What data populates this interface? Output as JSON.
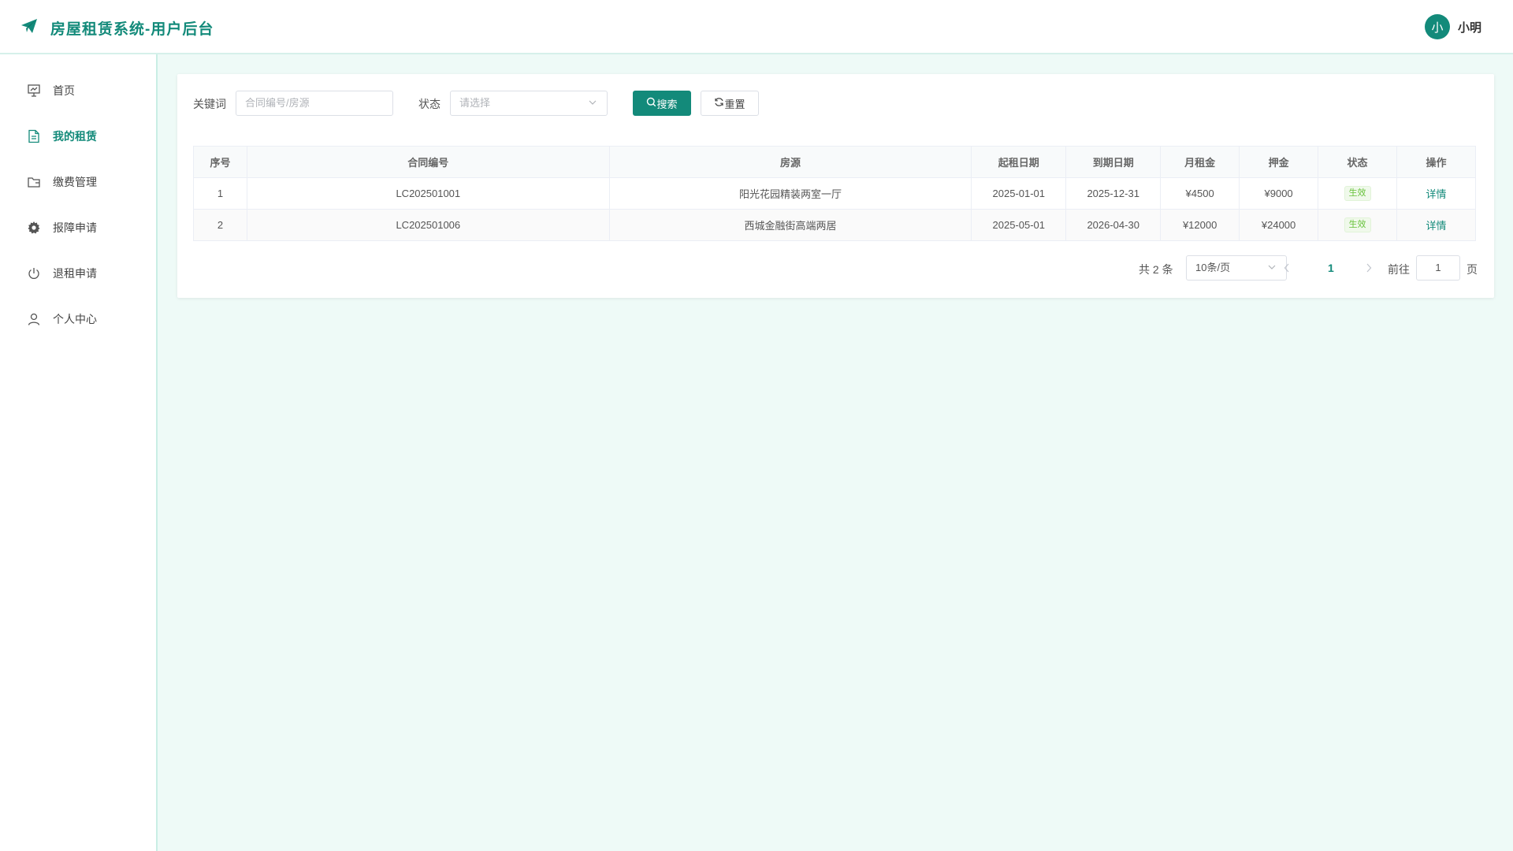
{
  "header": {
    "title": "房屋租赁系统-用户后台",
    "avatar_text": "小",
    "username": "小明",
    "accent": "#138a7a"
  },
  "sidebar": {
    "items": [
      {
        "label": "首页",
        "icon": "presentation-icon",
        "active": false
      },
      {
        "label": "我的租赁",
        "icon": "document-icon",
        "active": true
      },
      {
        "label": "缴费管理",
        "icon": "folder-icon",
        "active": false
      },
      {
        "label": "报障申请",
        "icon": "gear-icon",
        "active": false
      },
      {
        "label": "退租申请",
        "icon": "power-icon",
        "active": false
      },
      {
        "label": "个人中心",
        "icon": "user-icon",
        "active": false
      }
    ]
  },
  "filters": {
    "keyword_label": "关键词",
    "keyword_placeholder": "合同编号/房源",
    "status_label": "状态",
    "status_placeholder": "请选择",
    "search_label": "搜索",
    "reset_label": "重置"
  },
  "table": {
    "columns": [
      "序号",
      "合同编号",
      "房源",
      "起租日期",
      "到期日期",
      "月租金",
      "押金",
      "状态",
      "操作"
    ],
    "rows": [
      {
        "index": "1",
        "contract": "LC202501001",
        "property": "阳光花园精装两室一厅",
        "start": "2025-01-01",
        "end": "2025-12-31",
        "rent": "¥4500",
        "deposit": "¥9000",
        "status": "生效",
        "action": "详情"
      },
      {
        "index": "2",
        "contract": "LC202501006",
        "property": "西城金融街高端两居",
        "start": "2025-05-01",
        "end": "2026-04-30",
        "rent": "¥12000",
        "deposit": "¥24000",
        "status": "生效",
        "action": "详情"
      }
    ]
  },
  "pagination": {
    "total_text": "共 2 条",
    "page_size": "10条/页",
    "current_page": "1",
    "goto_label": "前往",
    "goto_value": "1",
    "page_suffix": "页"
  }
}
